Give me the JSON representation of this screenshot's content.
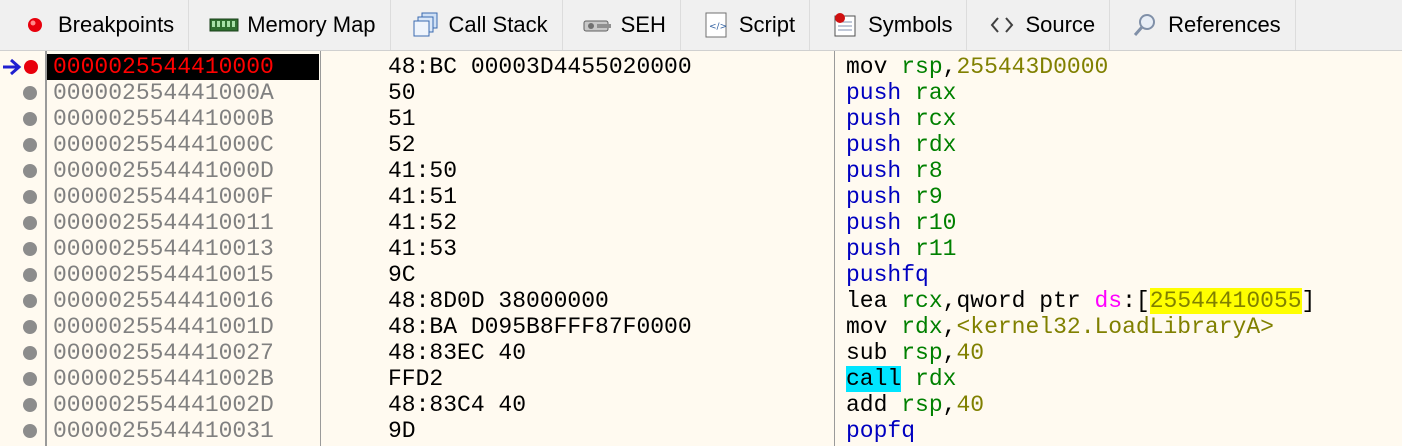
{
  "tabs": [
    {
      "label": "Breakpoints",
      "icon": "breakpoint-icon"
    },
    {
      "label": "Memory Map",
      "icon": "memory-map-icon"
    },
    {
      "label": "Call Stack",
      "icon": "call-stack-icon"
    },
    {
      "label": "SEH",
      "icon": "seh-icon"
    },
    {
      "label": "Script",
      "icon": "script-icon"
    },
    {
      "label": "Symbols",
      "icon": "symbols-icon"
    },
    {
      "label": "Source",
      "icon": "source-icon"
    },
    {
      "label": "References",
      "icon": "references-icon"
    }
  ],
  "colors": {
    "breakpoint": "#e8000c",
    "current_address_bg": "#000000",
    "current_address_fg": "#ff0000",
    "register": "#008000",
    "immediate": "#808000",
    "mnemonic_push": "#0000c0",
    "call_highlight": "#00e5ff",
    "address_highlight": "#ffff00"
  },
  "rows": [
    {
      "address": "0000025544410000",
      "bytes": "48:BC 00003D4455020000",
      "mnemonic": "mov",
      "ops": [
        {
          "t": "rsp",
          "c": "rg"
        },
        {
          "t": ",",
          "c": "kw"
        },
        {
          "t": "255443D0000",
          "c": "imm"
        }
      ],
      "current": true,
      "breakpoint": true
    },
    {
      "address": "000002554441000A",
      "bytes": "50",
      "mnemonic": "push",
      "ops": [
        {
          "t": "rax",
          "c": "rg"
        }
      ]
    },
    {
      "address": "000002554441000B",
      "bytes": "51",
      "mnemonic": "push",
      "ops": [
        {
          "t": "rcx",
          "c": "rg"
        }
      ]
    },
    {
      "address": "000002554441000C",
      "bytes": "52",
      "mnemonic": "push",
      "ops": [
        {
          "t": "rdx",
          "c": "rg"
        }
      ]
    },
    {
      "address": "000002554441000D",
      "bytes": "41:50",
      "mnemonic": "push",
      "ops": [
        {
          "t": "r8",
          "c": "rg"
        }
      ]
    },
    {
      "address": "000002554441000F",
      "bytes": "41:51",
      "mnemonic": "push",
      "ops": [
        {
          "t": "r9",
          "c": "rg"
        }
      ]
    },
    {
      "address": "0000025544410011",
      "bytes": "41:52",
      "mnemonic": "push",
      "ops": [
        {
          "t": "r10",
          "c": "rg"
        }
      ]
    },
    {
      "address": "0000025544410013",
      "bytes": "41:53",
      "mnemonic": "push",
      "ops": [
        {
          "t": "r11",
          "c": "rg"
        }
      ]
    },
    {
      "address": "0000025544410015",
      "bytes": "9C",
      "mnemonic": "pushfq",
      "ops": []
    },
    {
      "address": "0000025544410016",
      "bytes": "48:8D0D 38000000",
      "mnemonic": "lea",
      "ops": [
        {
          "t": "rcx",
          "c": "rg"
        },
        {
          "t": ",",
          "c": "kw"
        },
        {
          "t": "qword ptr ",
          "c": "kw"
        },
        {
          "t": "ds",
          "c": "seg"
        },
        {
          "t": ":[",
          "c": "kw"
        },
        {
          "t": "25544410055",
          "c": "addrhl"
        },
        {
          "t": "]",
          "c": "kw"
        }
      ]
    },
    {
      "address": "000002554441001D",
      "bytes": "48:BA D095B8FFF87F0000",
      "mnemonic": "mov",
      "ops": [
        {
          "t": "rdx",
          "c": "rg"
        },
        {
          "t": ",",
          "c": "kw"
        },
        {
          "t": "<kernel32.LoadLibraryA>",
          "c": "sym"
        }
      ]
    },
    {
      "address": "0000025544410027",
      "bytes": "48:83EC 40",
      "mnemonic": "sub",
      "ops": [
        {
          "t": "rsp",
          "c": "rg"
        },
        {
          "t": ",",
          "c": "kw"
        },
        {
          "t": "40",
          "c": "imm"
        }
      ]
    },
    {
      "address": "000002554441002B",
      "bytes": "FFD2",
      "mnemonic": "call",
      "ops": [
        {
          "t": "rdx",
          "c": "rg"
        }
      ],
      "call": true
    },
    {
      "address": "000002554441002D",
      "bytes": "48:83C4 40",
      "mnemonic": "add",
      "ops": [
        {
          "t": "rsp",
          "c": "rg"
        },
        {
          "t": ",",
          "c": "kw"
        },
        {
          "t": "40",
          "c": "imm"
        }
      ]
    },
    {
      "address": "0000025544410031",
      "bytes": "9D",
      "mnemonic": "popfq",
      "ops": []
    }
  ]
}
